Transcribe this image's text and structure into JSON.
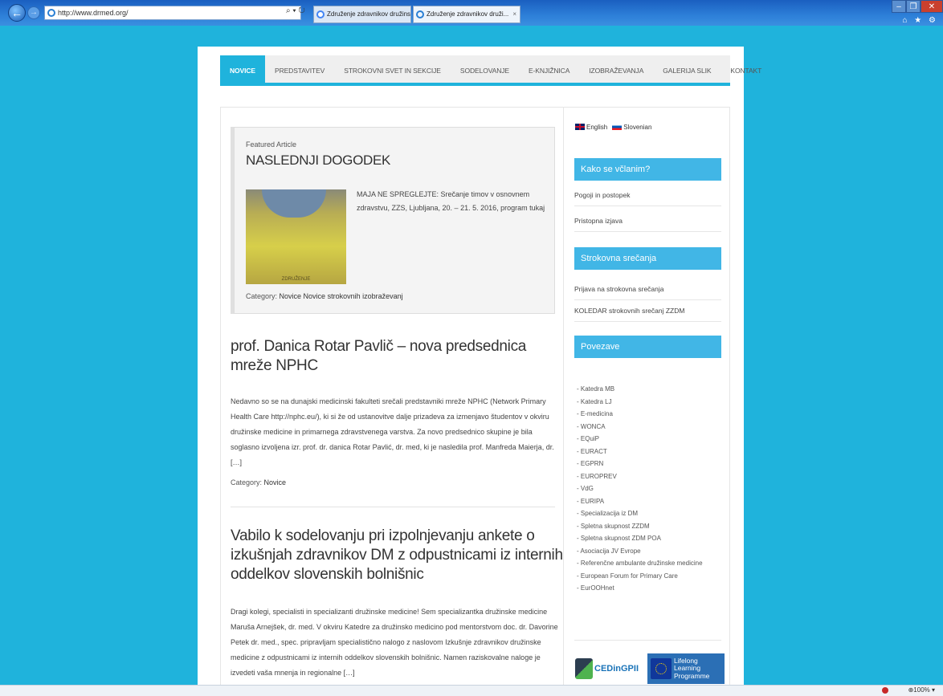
{
  "browser": {
    "address": "http://www.drmed.org/",
    "address_controls": "⌕ ▾ ↻",
    "tabs": [
      {
        "label": "Združenje zdravnikov družinske..."
      },
      {
        "label": "Združenje zdravnikov druži...",
        "close": "×"
      }
    ],
    "window_controls": {
      "minimize": "–",
      "restore": "❐",
      "close": "✕"
    },
    "toolbar_icons": "⌂ ★ ⚙",
    "zoom": "⊕100% ▾"
  },
  "nav": {
    "items": [
      {
        "label": "NOVICE",
        "active": true
      },
      {
        "label": "PREDSTAVITEV"
      },
      {
        "label": "STROKOVNI SVET IN SEKCIJE"
      },
      {
        "label": "SODELOVANJE"
      },
      {
        "label": "E-KNJIŽNICA"
      },
      {
        "label": "IZOBRAŽEVANJA"
      },
      {
        "label": "GALERIJA SLIK"
      },
      {
        "label": "KONTAKT"
      }
    ]
  },
  "featured": {
    "label": "Featured Article",
    "title": "NASLEDNJI DOGODEK",
    "image_caption": "ZDRUŽENJE",
    "text": "MAJA NE SPREGLEJTE: Srečanje timov v osnovnem zdravstvu, ZZS, Ljubljana, 20. – 21. 5. 2016, program tukaj",
    "category_label": "Category:",
    "categories": "Novice  Novice strokovnih izobraževanj"
  },
  "posts": [
    {
      "title": "prof. Danica Rotar Pavlič – nova predsednica mreže NPHC",
      "body": "Nedavno so se na dunajski medicinski fakulteti srečali predstavniki mreže NPHC (Network Primary Health Care http://nphc.eu/), ki si že od ustanovitve dalje prizadeva za izmenjavo študentov v okviru družinske medicine in primarnega zdravstvenega varstva. Za novo predsednico skupine je bila soglasno izvoljena izr. prof. dr. danica Rotar Pavlić, dr. med, ki je nasledila prof. Manfreda Maierja, dr. […]",
      "category_label": "Category:",
      "category": "Novice"
    },
    {
      "title": "Vabilo k sodelovanju pri izpolnjevanju ankete o izkušnjah zdravnikov DM z odpustnicami iz internih oddelkov slovenskih bolnišnic",
      "body": "Dragi kolegi, specialisti in specializanti družinske medicine! Sem specializantka družinske medicine Maruša Arnejšek, dr. med. V okviru Katedre za družinsko medicino pod mentorstvom doc. dr. Davorine Petek dr. med., spec. pripravljam specialistično nalogo z naslovom Izkušnje zdravnikov družinske medicine z odpustnicami iz internih oddelkov slovenskih bolnišnic. Namen raziskovalne naloge je izvedeti vaša mnenja in regionalne […]"
    }
  ],
  "sidebar": {
    "languages": [
      "English",
      "Slovenian"
    ],
    "sections": [
      {
        "heading": "Kako se včlanim?",
        "links": [
          "Pogoji in postopek",
          "Pristopna izjava"
        ]
      },
      {
        "heading": "Strokovna srečanja",
        "links": [
          "Prijava na strokovna srečanja",
          "KOLEDAR strokovnih srečanj ZZDM"
        ]
      },
      {
        "heading": "Povezave"
      }
    ],
    "links": [
      "- Katedra MB",
      "- Katedra LJ",
      "- E-medicina",
      "- WONCA",
      "- EQuiP",
      "- EURACT",
      "- EGPRN",
      "- EUROPREV",
      "- VdG",
      "- EURIPA",
      "- Specializacija iz DM",
      "- Spletna skupnost ZZDM",
      "- Spletna skupnost ZDM POA",
      "- Asociacija JV Evrope",
      "- Referenčne ambulante družinske medicine",
      "- European Forum for Primary Care",
      "- EurOOHnet"
    ],
    "logos": {
      "cedin": "CEDinGPII",
      "llp": [
        "Lifelong",
        "Learning",
        "Programme"
      ]
    }
  }
}
